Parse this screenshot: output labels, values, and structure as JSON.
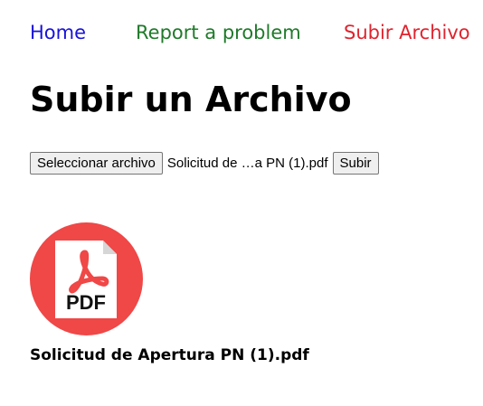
{
  "nav": {
    "home": "Home",
    "report": "Report a problem",
    "upload": "Subir Archivo"
  },
  "page": {
    "title": "Subir un Archivo"
  },
  "upload_form": {
    "choose_label": "Seleccionar archivo",
    "selected_file": "Solicitud de …a PN (1).pdf",
    "submit_label": "Subir"
  },
  "uploaded_file": {
    "icon": "pdf-file-icon",
    "icon_text": "PDF",
    "name": "Solicitud de Apertura PN (1).pdf"
  },
  "colors": {
    "home_link": "#1a12d9",
    "report_link": "#1f7a2a",
    "upload_link": "#e0232e",
    "pdf_circle": "#f04747"
  }
}
